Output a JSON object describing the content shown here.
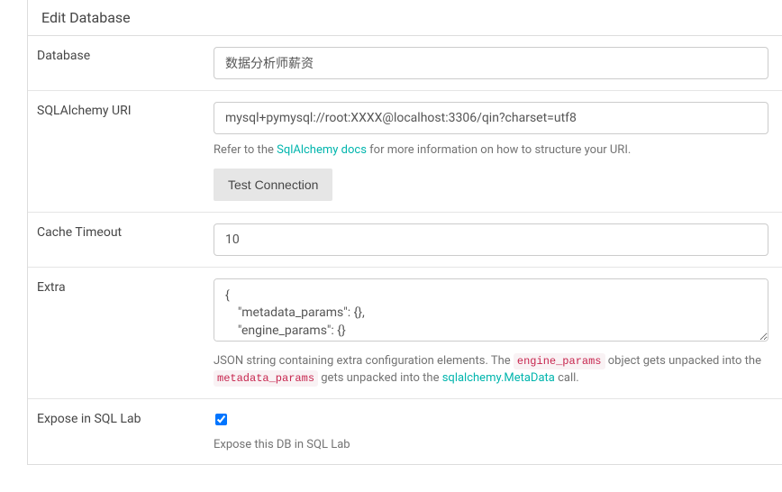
{
  "panel": {
    "heading": "Edit Database"
  },
  "form": {
    "database": {
      "label": "Database",
      "value": "数据分析师薪资"
    },
    "uri": {
      "label": "SQLAlchemy URI",
      "value": "mysql+pymysql://root:XXXX@localhost:3306/qin?charset=utf8",
      "help_prefix": "Refer to the ",
      "help_link": "SqlAlchemy docs",
      "help_suffix": " for more information on how to structure your URI.",
      "test_button": "Test Connection"
    },
    "cache": {
      "label": "Cache Timeout",
      "value": "10"
    },
    "extra": {
      "label": "Extra",
      "value": "{\n    \"metadata_params\": {},\n    \"engine_params\": {}\n}",
      "help1": "JSON string containing extra configuration elements. The ",
      "code1": "engine_params",
      "help2": " object gets unpacked into the ",
      "code2": "metadata_params",
      "help3": " gets unpacked into the ",
      "link1": "sqlalchemy.MetaData",
      "help4": " call."
    },
    "expose": {
      "label": "Expose in SQL Lab",
      "checked": "checked",
      "help": "Expose this DB in SQL Lab"
    }
  }
}
